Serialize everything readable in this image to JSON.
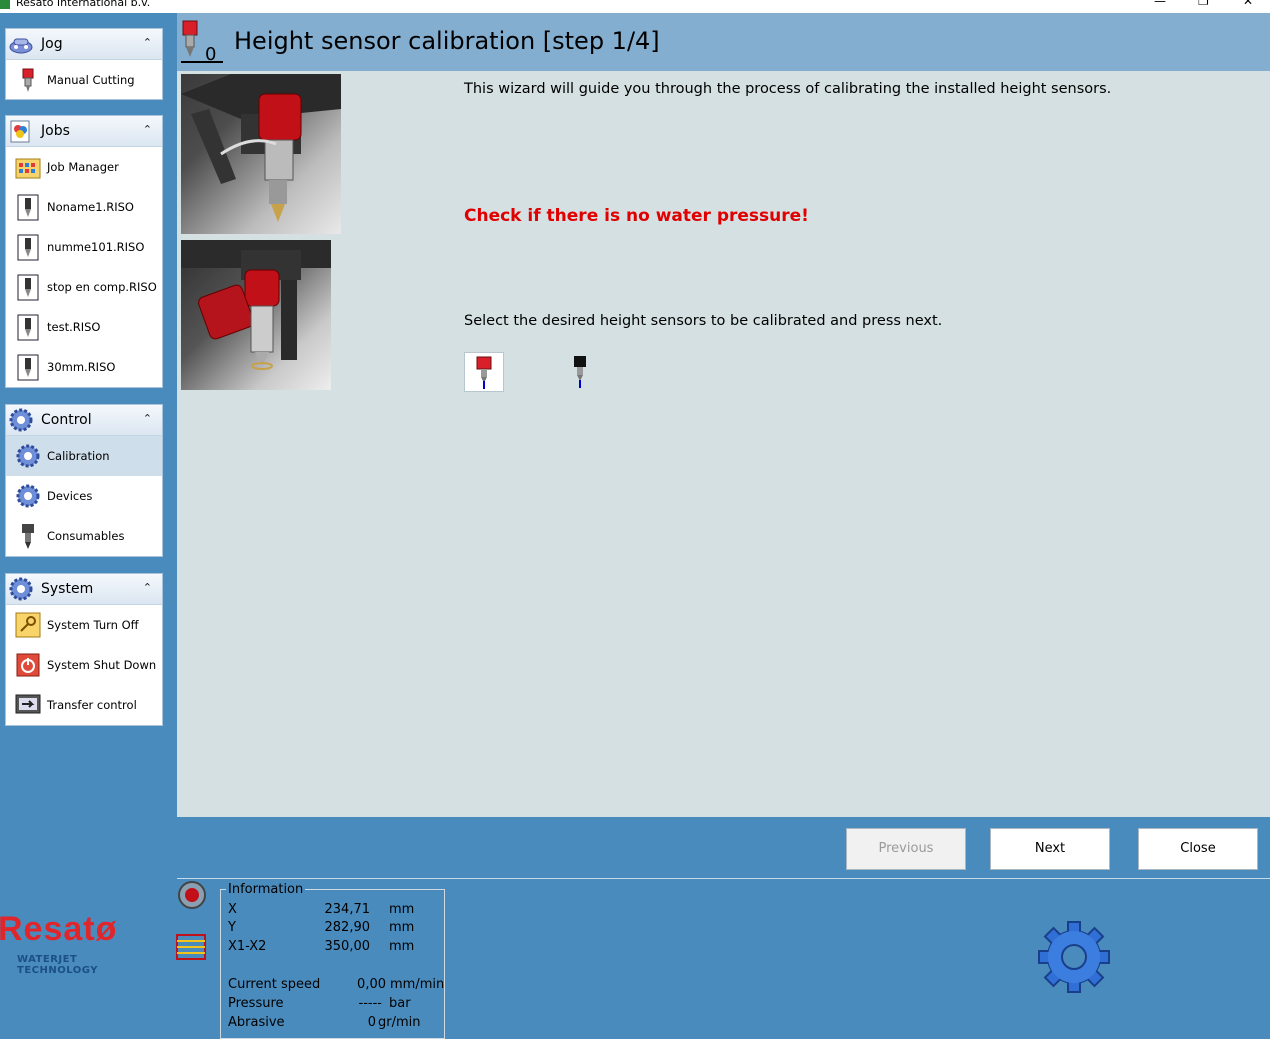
{
  "window": {
    "title": "Resato International b.v.",
    "minimize": "—",
    "maximize": "❐",
    "close": "✕"
  },
  "sidebar": {
    "jog": {
      "title": "Jog",
      "chevron": "⌃",
      "items": [
        {
          "label": "Manual Cutting"
        }
      ]
    },
    "jobs": {
      "title": "Jobs",
      "chevron": "⌃",
      "items": [
        {
          "label": "Job Manager"
        },
        {
          "label": "Noname1.RISO"
        },
        {
          "label": "numme101.RISO"
        },
        {
          "label": "stop en comp.RISO"
        },
        {
          "label": "test.RISO"
        },
        {
          "label": "30mm.RISO"
        }
      ]
    },
    "control": {
      "title": "Control",
      "chevron": "⌃",
      "items": [
        {
          "label": "Calibration"
        },
        {
          "label": "Devices"
        },
        {
          "label": "Consumables"
        }
      ]
    },
    "system": {
      "title": "System",
      "chevron": "⌃",
      "items": [
        {
          "label": "System Turn Off"
        },
        {
          "label": "System Shut Down"
        },
        {
          "label": "Transfer control"
        }
      ]
    }
  },
  "wizard": {
    "title": "Height sensor calibration [step 1/4]",
    "header_icon_digit": "0",
    "intro": "This wizard will guide you through the process of calibrating the installed height sensors.",
    "warning": "Check if there is no water pressure!",
    "instruction": "Select the desired height sensors to be calibrated and press next.",
    "buttons": {
      "previous": "Previous",
      "next": "Next",
      "close": "Close"
    }
  },
  "information": {
    "title": "Information",
    "rows": [
      {
        "label": "X",
        "value": "234,71",
        "unit": "mm"
      },
      {
        "label": "Y",
        "value": "282,90",
        "unit": "mm"
      },
      {
        "label": "X1-X2",
        "value": "350,00",
        "unit": "mm"
      },
      {
        "label": "Current speed",
        "value": "0,00",
        "unit": "mm/min"
      },
      {
        "label": "Pressure",
        "value": "-----",
        "unit": "bar"
      },
      {
        "label": "Abrasive",
        "value": "0",
        "unit": "gr/min"
      }
    ]
  },
  "logo": {
    "brand": "Resatø",
    "tagline": "WATERJET TECHNOLOGY"
  },
  "colors": {
    "accent_red": "#e00000",
    "panel_bg": "#d5e0e3",
    "header_bg": "#84aed0",
    "app_bg": "#4a8bbd"
  }
}
